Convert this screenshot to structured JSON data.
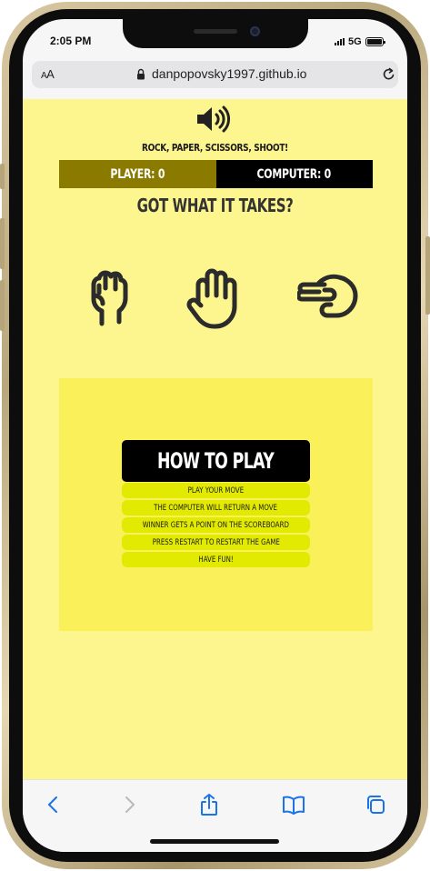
{
  "status_bar": {
    "time": "2:05 PM",
    "network": "5G"
  },
  "browser": {
    "aa_label_small": "A",
    "aa_label": "A",
    "url": "danpopovsky1997.github.io"
  },
  "game": {
    "tagline": "ROCK, PAPER, SCISSORS, SHOOT!",
    "player_score": "PLAYER: 0",
    "computer_score": "COMPUTER: 0",
    "challenge": "GOT WHAT IT TAKES?",
    "moves": [
      {
        "name": "rock",
        "icon": "fist-icon"
      },
      {
        "name": "paper",
        "icon": "open-hand-icon"
      },
      {
        "name": "scissors",
        "icon": "scissors-hand-icon"
      }
    ],
    "colors": {
      "page_bg": "#fdf68e",
      "box_bg": "#f9f05a",
      "item_bg": "#e1ea00",
      "player_bg": "#8a7a00",
      "computer_bg": "#000000"
    }
  },
  "how_to_play": {
    "title": "HOW TO PLAY",
    "steps": [
      "PLAY YOUR MOVE",
      "THE COMPUTER WILL RETURN A MOVE",
      "WINNER GETS A POINT ON THE SCOREBOARD",
      "PRESS RESTART TO RESTART THE GAME",
      "HAVE FUN!"
    ]
  },
  "toolbar": {
    "icons": [
      "back-icon",
      "forward-icon",
      "share-icon",
      "bookmarks-icon",
      "tabs-icon"
    ],
    "accent": "#1a73e8"
  }
}
